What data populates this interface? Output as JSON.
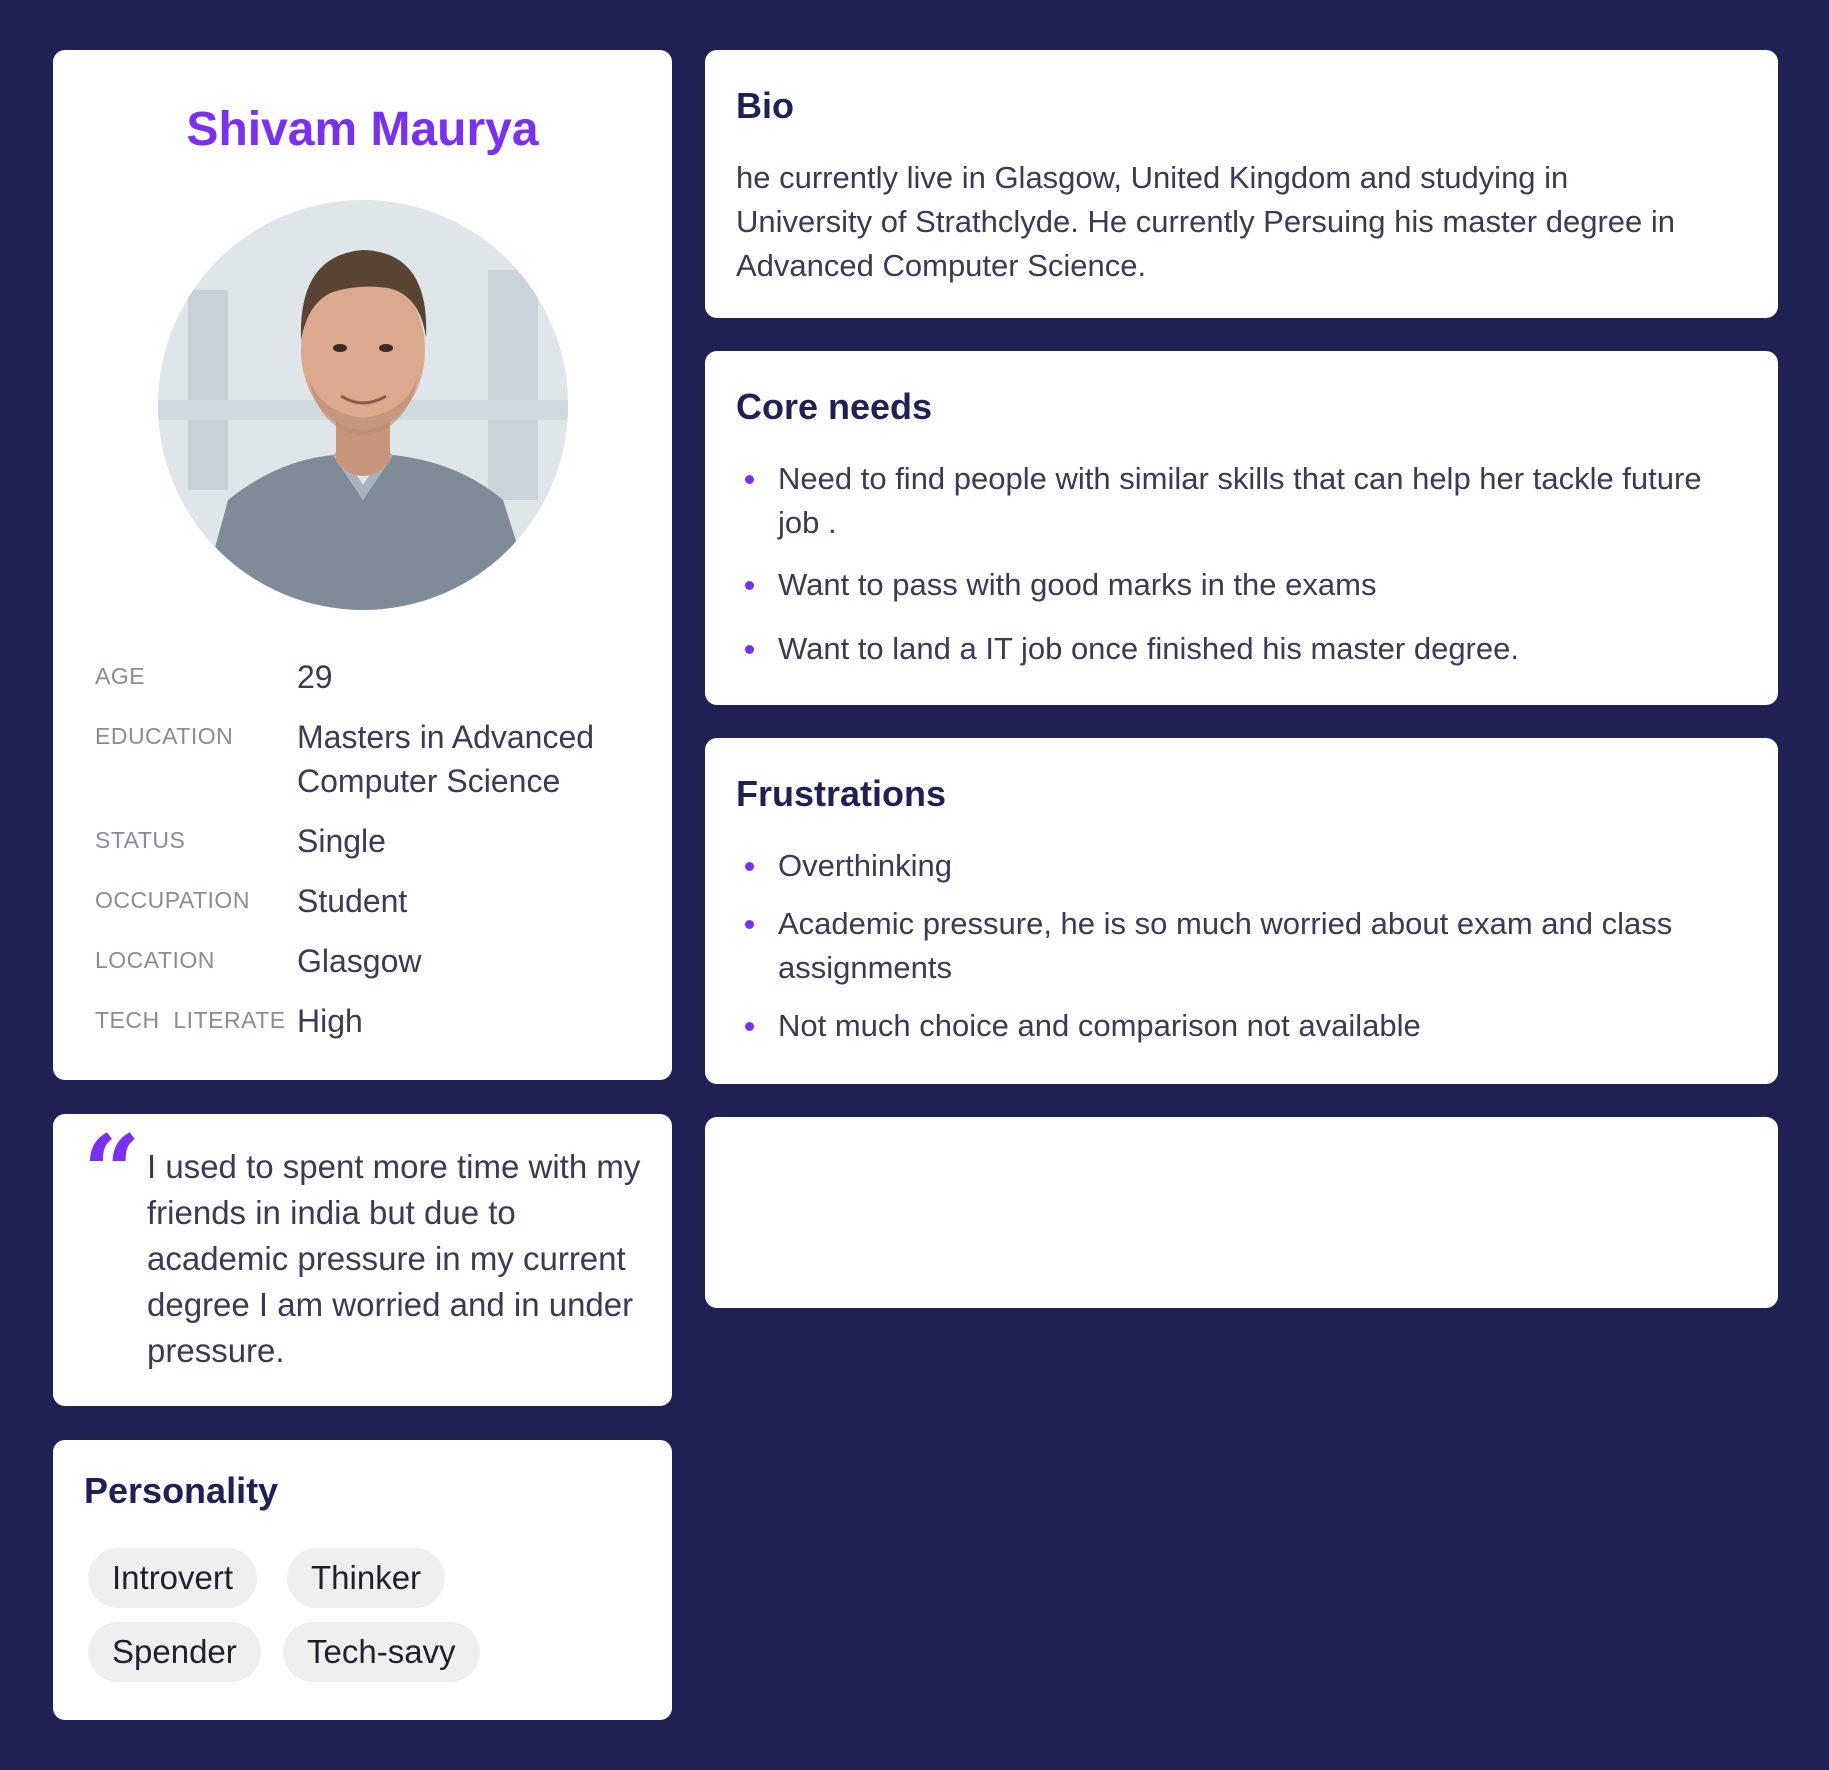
{
  "profile": {
    "name": "Shivam Maurya",
    "avatar_icon": "person-photo",
    "fields": [
      {
        "label": "AGE",
        "value": "29"
      },
      {
        "label": "EDUCATION",
        "value": "Masters in Advanced Computer Science"
      },
      {
        "label": "STATUS",
        "value": "Single"
      },
      {
        "label": "OCCUPATION",
        "value": "Student"
      },
      {
        "label": "LOCATION",
        "value": "Glasgow"
      },
      {
        "label": "TECH  LITERATE",
        "value": "High"
      }
    ]
  },
  "quote": {
    "mark": "“",
    "text": "I used to spent more time with my friends in india but due to academic pressure in my current degree I am worried and in under pressure."
  },
  "personality": {
    "title": "Personality",
    "traits": [
      "Introvert",
      "Thinker",
      "Spender",
      "Tech-savy"
    ]
  },
  "bio": {
    "title": "Bio",
    "text": "he currently live in Glasgow, United Kingdom and studying in University of Strathclyde. He currently Persuing his master degree in Advanced Computer Science."
  },
  "core_needs": {
    "title": "Core needs",
    "items": [
      "Need to find people with similar skills that can help her tackle future job .",
      "Want to pass with good marks in the exams",
      "Want to land a IT job once finished his master degree."
    ]
  },
  "frustrations": {
    "title": "Frustrations",
    "items": [
      "Overthinking",
      "Academic pressure, he is  so much worried about exam and class assignments",
      "Not much choice and comparison not available"
    ]
  },
  "colors": {
    "background": "#1f2152",
    "accent": "#7a2ff5",
    "card": "#ffffff",
    "chip": "#efefef"
  }
}
